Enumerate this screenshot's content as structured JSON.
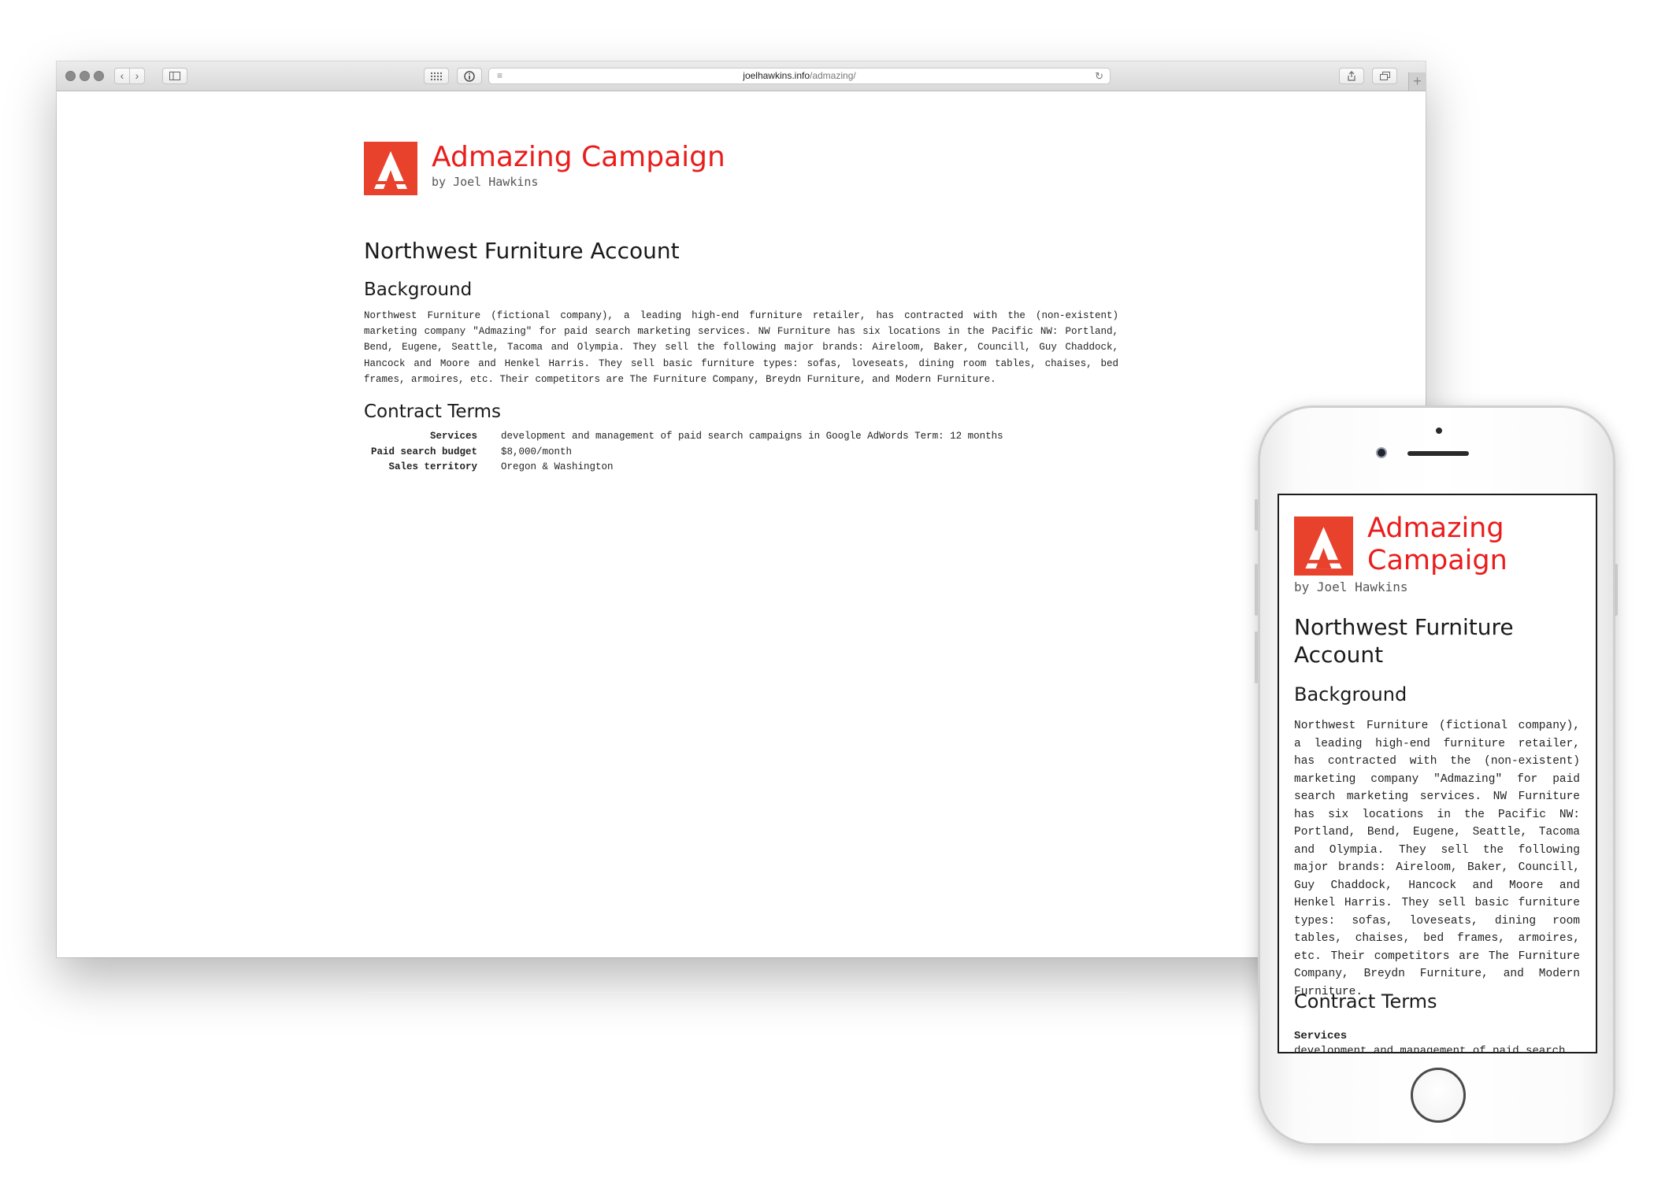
{
  "browser": {
    "url_host": "joelhawkins.info",
    "url_path": "/admazing/",
    "icons": {
      "back": "chevron-left-icon",
      "forward": "chevron-right-icon",
      "sidebar": "sidebar-icon",
      "top_sites": "grid-icon",
      "privacy": "info-icon",
      "reader": "reader-icon",
      "reload": "reload-icon",
      "share": "share-icon",
      "tabs": "tabs-icon",
      "new_tab": "plus-icon"
    }
  },
  "site": {
    "brand_title": "Admazing Campaign",
    "brand_title_line1": "Admazing",
    "brand_title_line2": "Campaign",
    "byline": "by Joel Hawkins",
    "account_title": "Northwest Furniture Account",
    "background_heading": "Background",
    "background_text": "Northwest Furniture (fictional company), a leading high-end furniture retailer, has contracted with the (non-existent) marketing company \"Admazing\" for paid search marketing services. NW Furniture has six locations in the Pacific NW: Portland, Bend, Eugene, Seattle, Tacoma and Olympia. They sell the following major brands: Aireloom, Baker, Councill, Guy Chaddock, Hancock and Moore and Henkel Harris. They sell basic furniture types: sofas, loveseats, dining room tables, chaises, bed frames, armoires, etc. Their competitors are The Furniture Company, Breydn Furniture, and Modern Furniture.",
    "contract_heading": "Contract Terms",
    "terms": [
      {
        "key": "Services",
        "value": "development and management of paid search campaigns in Google AdWords Term: 12 months"
      },
      {
        "key": "Paid search budget",
        "value": "$8,000/month"
      },
      {
        "key": "Sales territory",
        "value": "Oregon & Washington"
      }
    ]
  },
  "mobile": {
    "services_visible_text": "development and management of paid search"
  },
  "colors": {
    "brand_red": "#ea1d1d",
    "logo_bg": "#e8412c"
  }
}
